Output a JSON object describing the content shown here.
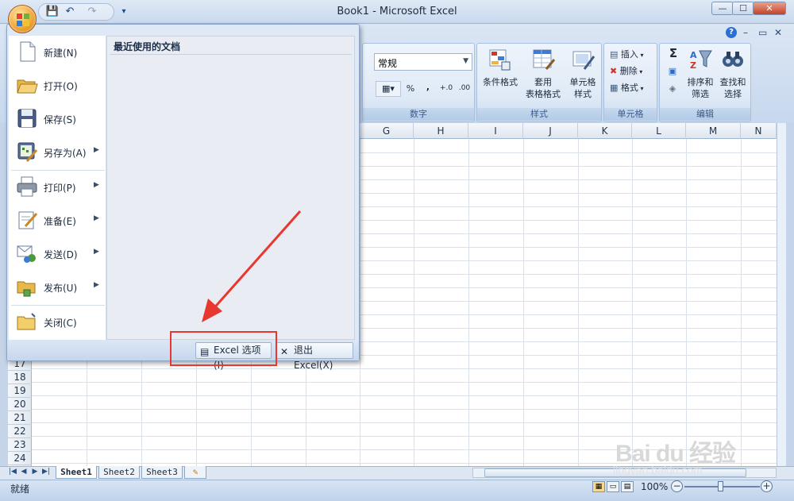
{
  "window": {
    "title": "Book1 - Microsoft Excel",
    "controls": {
      "minimize": "—",
      "maximize": "☐",
      "close": "✕"
    },
    "mdi": {
      "help": "?",
      "minimize": "–",
      "restore": "▭",
      "close": "✕"
    }
  },
  "qat": {
    "save": "💾",
    "undo": "↶",
    "redo": "↷",
    "customize": "▾"
  },
  "ribbon": {
    "number": {
      "format_value": "常规",
      "buttons": [
        "%",
        ",",
        "+.0",
        ".00"
      ],
      "label": "数字"
    },
    "styles": {
      "conditional": "条件格式",
      "table_line1": "套用",
      "table_line2": "表格格式",
      "cell_line1": "单元格",
      "cell_line2": "样式",
      "label": "样式"
    },
    "cells": {
      "insert": "插入",
      "delete": "删除",
      "format": "格式",
      "label": "单元格"
    },
    "editing": {
      "sum_icon": "Σ",
      "sort_line1": "排序和",
      "sort_line2": "筛选",
      "find_line1": "查找和",
      "find_line2": "选择",
      "label": "编辑"
    }
  },
  "grid": {
    "columns": [
      "G",
      "H",
      "I",
      "J",
      "K",
      "L",
      "M",
      "N"
    ],
    "rows": [
      "17",
      "18",
      "19",
      "20",
      "21",
      "22",
      "23",
      "24"
    ]
  },
  "office_menu": {
    "recent_title": "最近使用的文档",
    "items": [
      {
        "label": "新建(N)",
        "icon": "new-document-icon"
      },
      {
        "label": "打开(O)",
        "icon": "open-folder-icon"
      },
      {
        "label": "保存(S)",
        "icon": "save-disk-icon"
      },
      {
        "label": "另存为(A)",
        "icon": "save-as-icon",
        "arrow": "▶"
      },
      {
        "label": "打印(P)",
        "icon": "printer-icon",
        "arrow": "▶"
      },
      {
        "label": "准备(E)",
        "icon": "prepare-icon",
        "arrow": "▶"
      },
      {
        "label": "发送(D)",
        "icon": "send-icon",
        "arrow": "▶"
      },
      {
        "label": "发布(U)",
        "icon": "publish-icon",
        "arrow": "▶"
      },
      {
        "label": "关闭(C)",
        "icon": "close-folder-icon"
      }
    ],
    "options_button": "Excel 选项(I)",
    "exit_button": "退出 Excel(X)"
  },
  "sheets": {
    "tabs": [
      "Sheet1",
      "Sheet2",
      "Sheet3"
    ],
    "nav": [
      "|◀",
      "◀",
      "▶",
      "▶|"
    ]
  },
  "status": {
    "ready": "就绪",
    "zoom": "100%",
    "zoom_minus": "−",
    "zoom_plus": "+"
  },
  "watermark": {
    "brand": "Bai du 经验",
    "url": "jingyan.baidu.com"
  },
  "colors": {
    "annotation": "#e8372e",
    "frame": "#c5d4e8",
    "menu_bg": "#dfe9f5"
  }
}
